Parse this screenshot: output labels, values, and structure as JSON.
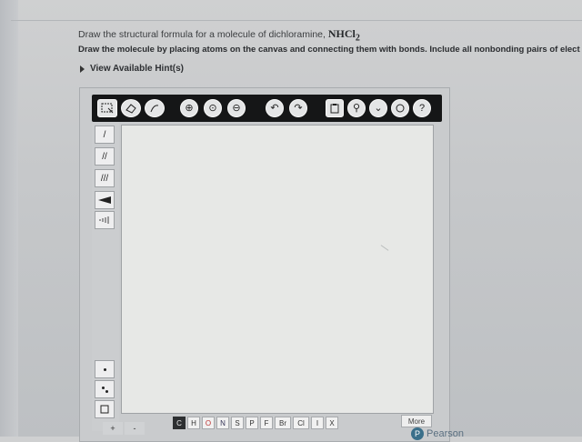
{
  "question": {
    "prefix": "Draw the structural formula for a molecule of dichloramine,",
    "formula_main": "NHCl",
    "formula_sub": "2"
  },
  "instruction": "Draw the molecule by placing atoms on the canvas and connecting them with bonds. Include all nonbonding pairs of elect",
  "hint_label": "View Available Hint(s)",
  "toolbar": {
    "zoom_in": "⊕",
    "zoom_fit": "⊙",
    "zoom_out": "⊖",
    "undo": "↶",
    "redo": "↷",
    "info": "⚲",
    "chevron": "⌄",
    "help": "?"
  },
  "left_tools": {
    "single_bond": "/",
    "double_bond": "//",
    "triple_bond": "///",
    "charge_plus": "+",
    "charge_minus": "-"
  },
  "atoms": [
    "C",
    "H",
    "O",
    "N",
    "S",
    "P",
    "F",
    "Br",
    "Cl",
    "I",
    "X"
  ],
  "more_label": "More",
  "brand_label": "Pearson"
}
